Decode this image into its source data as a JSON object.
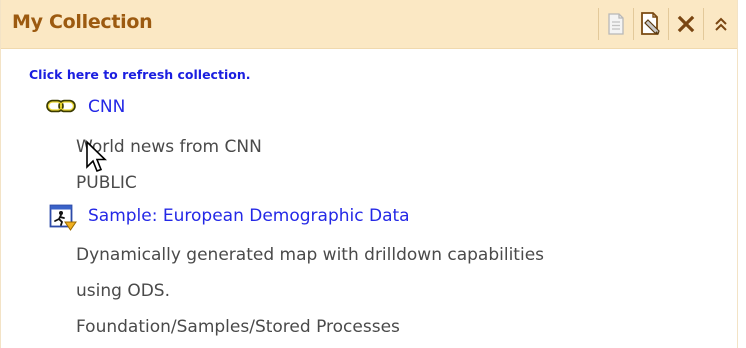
{
  "portlet": {
    "title": "My Collection",
    "tools": [
      {
        "icon": "document-icon"
      },
      {
        "icon": "edit-document-icon"
      },
      {
        "icon": "close-icon"
      },
      {
        "icon": "collapse-icon"
      }
    ]
  },
  "refresh_link": "Click here to refresh collection.",
  "items": [
    {
      "icon": "link-icon",
      "title": "CNN",
      "description": "World news from CNN",
      "location": "PUBLIC"
    },
    {
      "icon": "stored-process-icon",
      "title": "Sample: European Demographic Data",
      "description_line1": "Dynamically generated map with drilldown capabilities",
      "description_line2": "using ODS.",
      "location": "Foundation/Samples/Stored Processes"
    }
  ],
  "colors": {
    "titlebar_bg": "#fbe8c4",
    "title_text": "#9c5a10",
    "link": "#2428e6",
    "body_text": "#4a4a4a"
  }
}
